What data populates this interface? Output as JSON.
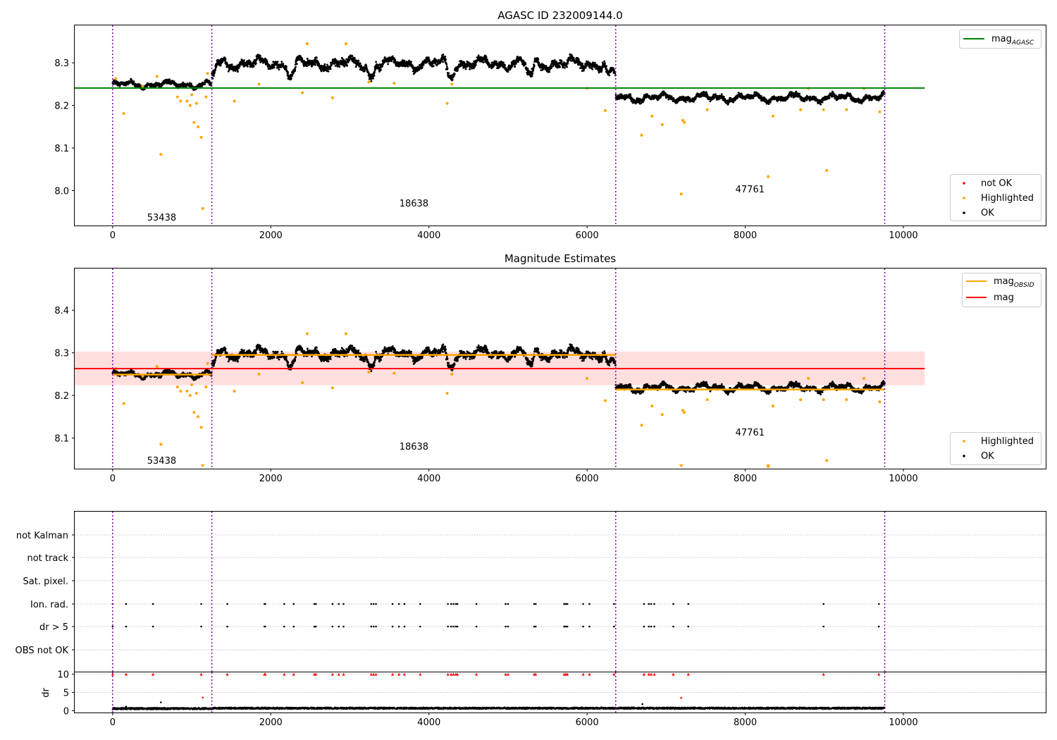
{
  "chart_data": [
    {
      "type": "scatter",
      "title": "AGASC ID 232009144.0",
      "xlim": [
        -480,
        11800
      ],
      "ylim": [
        7.918,
        8.388
      ],
      "xticks": [
        0,
        2000,
        4000,
        6000,
        8000,
        10000
      ],
      "xtick_labels": [
        "0",
        "2000",
        "4000",
        "6000",
        "8000",
        "10000"
      ],
      "yticks": [
        8.0,
        8.1,
        8.2,
        8.3
      ],
      "ytick_labels": [
        "8.0",
        "8.1",
        "8.2",
        "8.3"
      ],
      "vlines": [
        0,
        1254,
        6362,
        9764
      ],
      "obsid_labels": [
        {
          "text": "53438",
          "x": 620,
          "y": 7.938
        },
        {
          "text": "18638",
          "x": 3810,
          "y": 7.971
        },
        {
          "text": "47761",
          "x": 8060,
          "y": 8.004
        }
      ],
      "hlines": [
        {
          "name": "mag_AGASC",
          "y": 8.241,
          "x": [
            -480,
            10270
          ],
          "color": "#008000"
        }
      ],
      "legend_top": {
        "position": "top-right",
        "entries": [
          {
            "main": "mag",
            "sub": "AGASC",
            "color": "#008000"
          }
        ]
      },
      "legend_bottom": {
        "position": "bottom-right",
        "entries": [
          {
            "label": "not OK",
            "color": "#ff0000"
          },
          {
            "label": "Highlighted",
            "color": "#ffa500"
          },
          {
            "label": "OK",
            "color": "#000000"
          }
        ]
      },
      "ok_segments": [
        {
          "x": [
            0,
            1254
          ],
          "mean": 8.249,
          "spread": 0.008
        },
        {
          "x": [
            1254,
            6300
          ],
          "mean": 8.298,
          "spread": 0.013
        },
        {
          "x": [
            6300,
            6362
          ],
          "mean": 8.27,
          "spread": 0.012
        },
        {
          "x": [
            6362,
            9764
          ],
          "mean": 8.218,
          "spread": 0.009
        }
      ],
      "highlighted_points": [
        [
          40,
          8.263
        ],
        [
          140,
          8.181
        ],
        [
          380,
          8.245
        ],
        [
          560,
          8.268
        ],
        [
          610,
          8.085
        ],
        [
          820,
          8.22
        ],
        [
          860,
          8.21
        ],
        [
          940,
          8.21
        ],
        [
          980,
          8.2
        ],
        [
          1000,
          8.225
        ],
        [
          1030,
          8.16
        ],
        [
          1060,
          8.205
        ],
        [
          1080,
          8.15
        ],
        [
          1120,
          8.125
        ],
        [
          1140,
          7.958
        ],
        [
          1180,
          8.22
        ],
        [
          1200,
          8.275
        ],
        [
          1540,
          8.21
        ],
        [
          1850,
          8.25
        ],
        [
          2400,
          8.23
        ],
        [
          2460,
          8.345
        ],
        [
          2780,
          8.218
        ],
        [
          2950,
          8.345
        ],
        [
          3240,
          8.255
        ],
        [
          3560,
          8.252
        ],
        [
          4230,
          8.205
        ],
        [
          4290,
          8.25
        ],
        [
          6000,
          8.24
        ],
        [
          6230,
          8.188
        ],
        [
          6690,
          8.13
        ],
        [
          6820,
          8.175
        ],
        [
          6950,
          8.155
        ],
        [
          7190,
          7.992
        ],
        [
          7210,
          8.165
        ],
        [
          7230,
          8.16
        ],
        [
          7520,
          8.19
        ],
        [
          8290,
          8.033
        ],
        [
          8350,
          8.175
        ],
        [
          8700,
          8.19
        ],
        [
          8800,
          8.24
        ],
        [
          8990,
          8.19
        ],
        [
          9030,
          8.047
        ],
        [
          9280,
          8.19
        ],
        [
          9500,
          8.24
        ],
        [
          9700,
          8.185
        ]
      ]
    },
    {
      "type": "scatter",
      "title": "Magnitude Estimates",
      "xlim": [
        -480,
        11800
      ],
      "ylim": [
        8.028,
        8.498
      ],
      "xticks": [
        0,
        2000,
        4000,
        6000,
        8000,
        10000
      ],
      "xtick_labels": [
        "0",
        "2000",
        "4000",
        "6000",
        "8000",
        "10000"
      ],
      "yticks": [
        8.1,
        8.2,
        8.3,
        8.4
      ],
      "ytick_labels": [
        "8.1",
        "8.2",
        "8.3",
        "8.4"
      ],
      "vlines": [
        0,
        1254,
        6362,
        9764
      ],
      "obsid_labels": [
        {
          "text": "53438",
          "x": 620,
          "y": 8.048
        },
        {
          "text": "18638",
          "x": 3810,
          "y": 8.081
        },
        {
          "text": "47761",
          "x": 8060,
          "y": 8.114
        }
      ],
      "mag_band": {
        "y": [
          8.224,
          8.303
        ],
        "x": [
          -480,
          10270
        ],
        "color": "#ffcccc"
      },
      "hlines": [
        {
          "name": "mag",
          "y": 8.263,
          "x": [
            -480,
            10270
          ],
          "color": "#ff0000"
        }
      ],
      "obsid_mags": [
        {
          "x": [
            0,
            1254
          ],
          "y": 8.249
        },
        {
          "x": [
            1254,
            6362
          ],
          "y": 8.295
        },
        {
          "x": [
            6362,
            9764
          ],
          "y": 8.214
        }
      ],
      "legend_top": {
        "position": "top-right",
        "entries": [
          {
            "main": "mag",
            "sub": "OBSID",
            "color": "#ffa500"
          },
          {
            "main": "mag",
            "sub": "",
            "color": "#ff0000"
          }
        ]
      },
      "legend_bottom": {
        "position": "bottom-right",
        "entries": [
          {
            "label": "Highlighted",
            "color": "#ffa500"
          },
          {
            "label": "OK",
            "color": "#000000"
          }
        ]
      },
      "clipped_markers": [
        1140,
        7190,
        8290
      ]
    },
    {
      "type": "scatter",
      "title": "",
      "xlim": [
        -480,
        11800
      ],
      "flag_rows": [
        "not Kalman",
        "not track",
        "Sat. pixel.",
        "Ion. rad.",
        "dr > 5",
        "OBS not OK"
      ],
      "flag_x": [
        0,
        170,
        510,
        1120,
        1450,
        1920,
        1930,
        2170,
        2290,
        2550,
        2570,
        2780,
        2860,
        2920,
        3270,
        3300,
        3330,
        3540,
        3620,
        3690,
        3890,
        4240,
        4280,
        4310,
        4340,
        4360,
        4600,
        4970,
        5000,
        5330,
        5350,
        5710,
        5730,
        5750,
        5950,
        6030,
        6340,
        6720,
        6780,
        6810,
        6850,
        7090,
        7280,
        8990,
        9690
      ],
      "xticks": [
        0,
        2000,
        4000,
        6000,
        8000,
        10000
      ],
      "xtick_labels": [
        "0",
        "2000",
        "4000",
        "6000",
        "8000",
        "10000"
      ],
      "vlines": [
        0,
        1254,
        6362,
        9764
      ],
      "dr": {
        "ylabel": "dr",
        "ylim": [
          -0.5,
          10.5
        ],
        "yticks": [
          0,
          5,
          10
        ],
        "ytick_labels": [
          "0",
          "5",
          "10"
        ],
        "outliers": [
          [
            170,
            1.1
          ],
          [
            610,
            2.3
          ],
          [
            1140,
            3.6
          ],
          [
            6700,
            1.8
          ],
          [
            7190,
            3.5
          ]
        ]
      }
    }
  ]
}
